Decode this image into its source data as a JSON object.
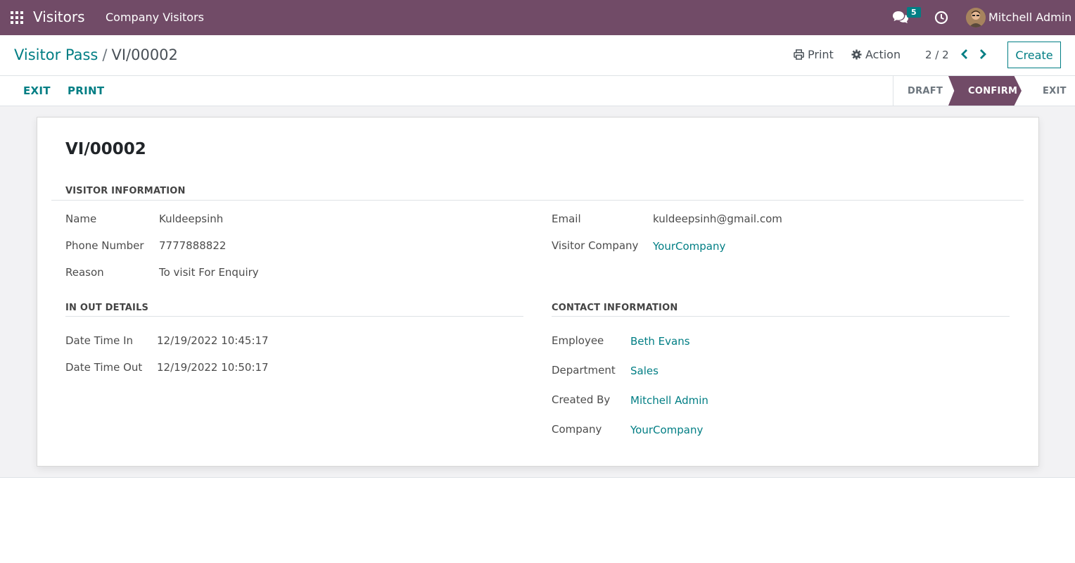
{
  "navbar": {
    "app_name": "Visitors",
    "menu_item": "Company Visitors",
    "chat_badge": "5",
    "user_name": "Mitchell Admin",
    "background_color": "#714b67"
  },
  "control_panel": {
    "breadcrumb_parent": "Visitor Pass",
    "breadcrumb_separator": "/",
    "breadcrumb_current": "VI/00002",
    "print_label": "Print",
    "action_label": "Action",
    "pager_value": "2 / 2",
    "create_label": "Create"
  },
  "statusbar": {
    "buttons": [
      "EXIT",
      "PRINT"
    ],
    "stages": [
      "DRAFT",
      "CONFIRM",
      "EXIT"
    ],
    "active_stage": "CONFIRM"
  },
  "form": {
    "title": "VI/00002",
    "visitor_information": {
      "heading": "VISITOR INFORMATION",
      "name_label": "Name",
      "name_value": "Kuldeepsinh",
      "phone_label": "Phone Number",
      "phone_value": "7777888822",
      "reason_label": "Reason",
      "reason_value": "To visit For Enquiry",
      "email_label": "Email",
      "email_value": "kuldeepsinh@gmail.com",
      "company_label": "Visitor Company",
      "company_value": "YourCompany"
    },
    "in_out_details": {
      "heading": "IN OUT DETAILS",
      "time_in_label": "Date Time In",
      "time_in_value": "12/19/2022 10:45:17",
      "time_out_label": "Date Time Out",
      "time_out_value": "12/19/2022 10:50:17"
    },
    "contact_information": {
      "heading": "CONTACT INFORMATION",
      "employee_label": "Employee",
      "employee_value": "Beth Evans",
      "department_label": "Department",
      "department_value": "Sales",
      "created_by_label": "Created By",
      "created_by_value": "Mitchell Admin",
      "company_label": "Company",
      "company_value": "YourCompany"
    }
  },
  "icons": {
    "apps": "apps-grid-icon",
    "chat": "chat-icon",
    "clock": "clock-icon",
    "print": "printer-icon",
    "action": "gear-icon",
    "prev": "chevron-left-icon",
    "next": "chevron-right-icon"
  }
}
